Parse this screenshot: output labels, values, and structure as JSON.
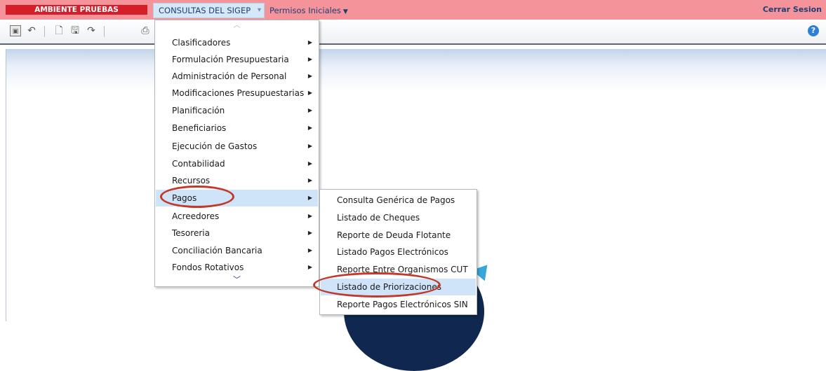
{
  "env_badge": "AMBIENTE PRUEBAS",
  "menubar": {
    "consultas": "CONSULTAS DEL SIGEP",
    "permisos": "Permisos Iniciales",
    "logout": "Cerrar Sesion"
  },
  "toolbar": {
    "icons": [
      "screen-icon",
      "undo-icon",
      "new-document-icon",
      "save-icon",
      "redo-icon",
      "print-icon"
    ],
    "help": "?"
  },
  "menu": {
    "items": [
      {
        "label": "Clasificadores"
      },
      {
        "label": "Formulación Presupuestaria"
      },
      {
        "label": "Administración de Personal"
      },
      {
        "label": "Modificaciones Presupuestarias"
      },
      {
        "label": "Planificación"
      },
      {
        "label": "Beneficiarios"
      },
      {
        "label": "Ejecución de Gastos"
      },
      {
        "label": "Contabilidad"
      },
      {
        "label": "Recursos"
      },
      {
        "label": "Pagos"
      },
      {
        "label": "Acreedores"
      },
      {
        "label": "Tesoreria"
      },
      {
        "label": "Conciliación Bancaria"
      },
      {
        "label": "Fondos Rotativos"
      }
    ]
  },
  "submenu": {
    "items": [
      {
        "label": "Consulta Genérica de Pagos"
      },
      {
        "label": "Listado de Cheques"
      },
      {
        "label": "Reporte de Deuda Flotante"
      },
      {
        "label": "Listado Pagos Electrónicos"
      },
      {
        "label": "Reporte Entre Organismos CUT"
      },
      {
        "label": "Listado de Priorizaciones"
      },
      {
        "label": "Reporte Pagos Electrónicos SIN"
      }
    ]
  },
  "colors": {
    "menubar_bg": "#f4949a",
    "badge_bg": "#d41f2a",
    "highlight": "#cfe4f8",
    "ring": "#c0392b"
  }
}
